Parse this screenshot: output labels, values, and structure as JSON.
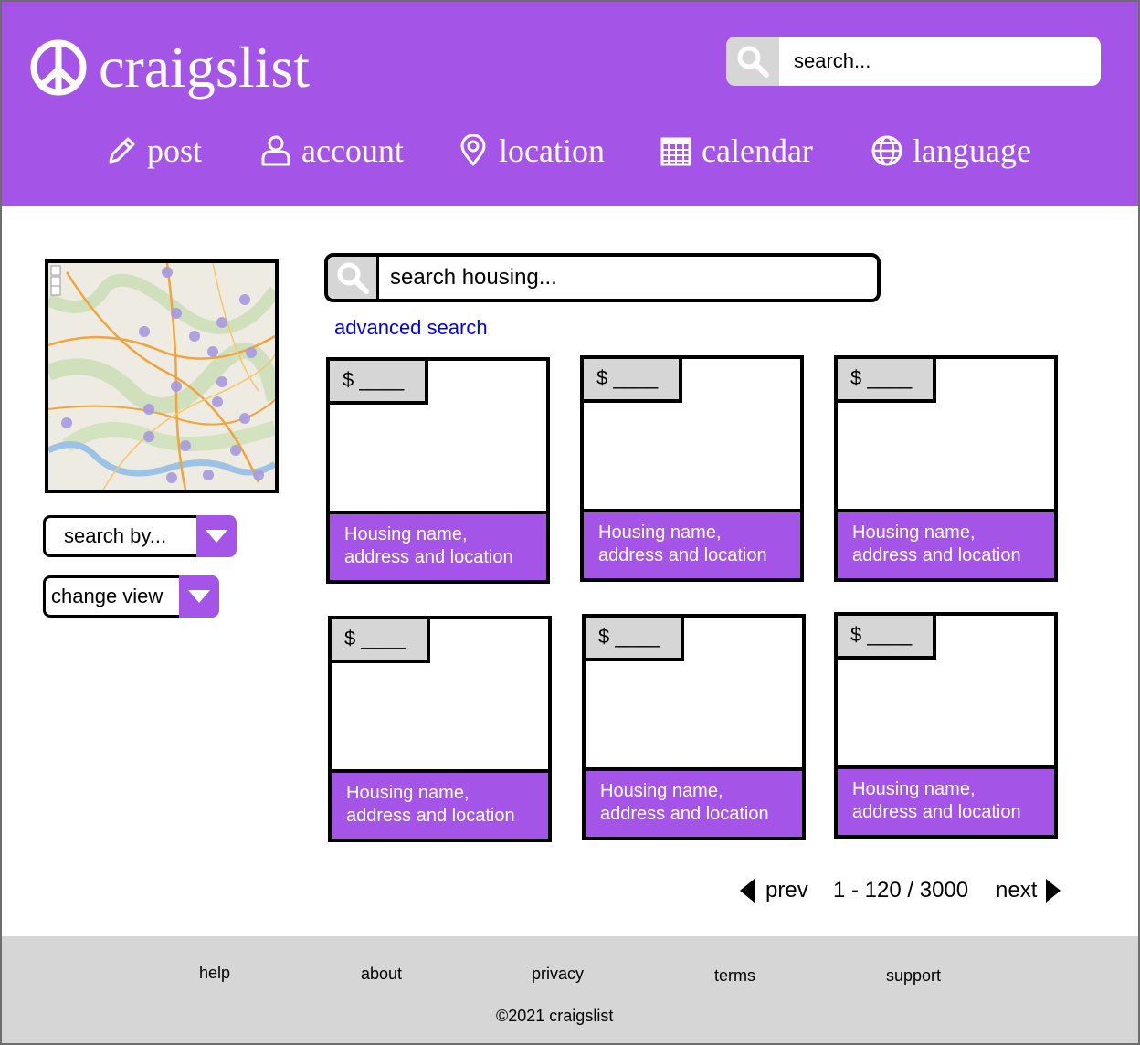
{
  "header": {
    "logo_text": "craigslist",
    "search_placeholder": "search...",
    "nav": [
      {
        "label": "post",
        "icon": "pencil-icon"
      },
      {
        "label": "account",
        "icon": "user-icon"
      },
      {
        "label": "location",
        "icon": "map-pin-icon"
      },
      {
        "label": "calendar",
        "icon": "calendar-icon"
      },
      {
        "label": "language",
        "icon": "globe-icon"
      }
    ]
  },
  "sidebar": {
    "map_icon": "map-thumbnail",
    "search_by": "search by...",
    "change_view": "change view"
  },
  "main": {
    "search_placeholder": "search housing...",
    "advanced_search": "advanced search",
    "listings": [
      {
        "price": "$ ____",
        "title": "Housing name,",
        "subtitle": "address and location"
      },
      {
        "price": "$ ____",
        "title": "Housing name,",
        "subtitle": "address and location"
      },
      {
        "price": "$ ____",
        "title": "Housing name,",
        "subtitle": "address and location"
      },
      {
        "price": "$ ____",
        "title": "Housing name,",
        "subtitle": "address and location"
      },
      {
        "price": "$ ____",
        "title": "Housing name,",
        "subtitle": "address and location"
      },
      {
        "price": "$ ____",
        "title": "Housing name,",
        "subtitle": "address and location"
      }
    ],
    "pagination": {
      "prev": "prev",
      "range": "1 - 120 / 3000",
      "next": "next"
    }
  },
  "footer": {
    "links": [
      "help",
      "about",
      "privacy",
      "terms",
      "support"
    ],
    "copyright": "©2021 craigslist"
  },
  "colors": {
    "accent": "#a455e8",
    "gray": "#d6d6d6",
    "link": "#0000ee"
  }
}
